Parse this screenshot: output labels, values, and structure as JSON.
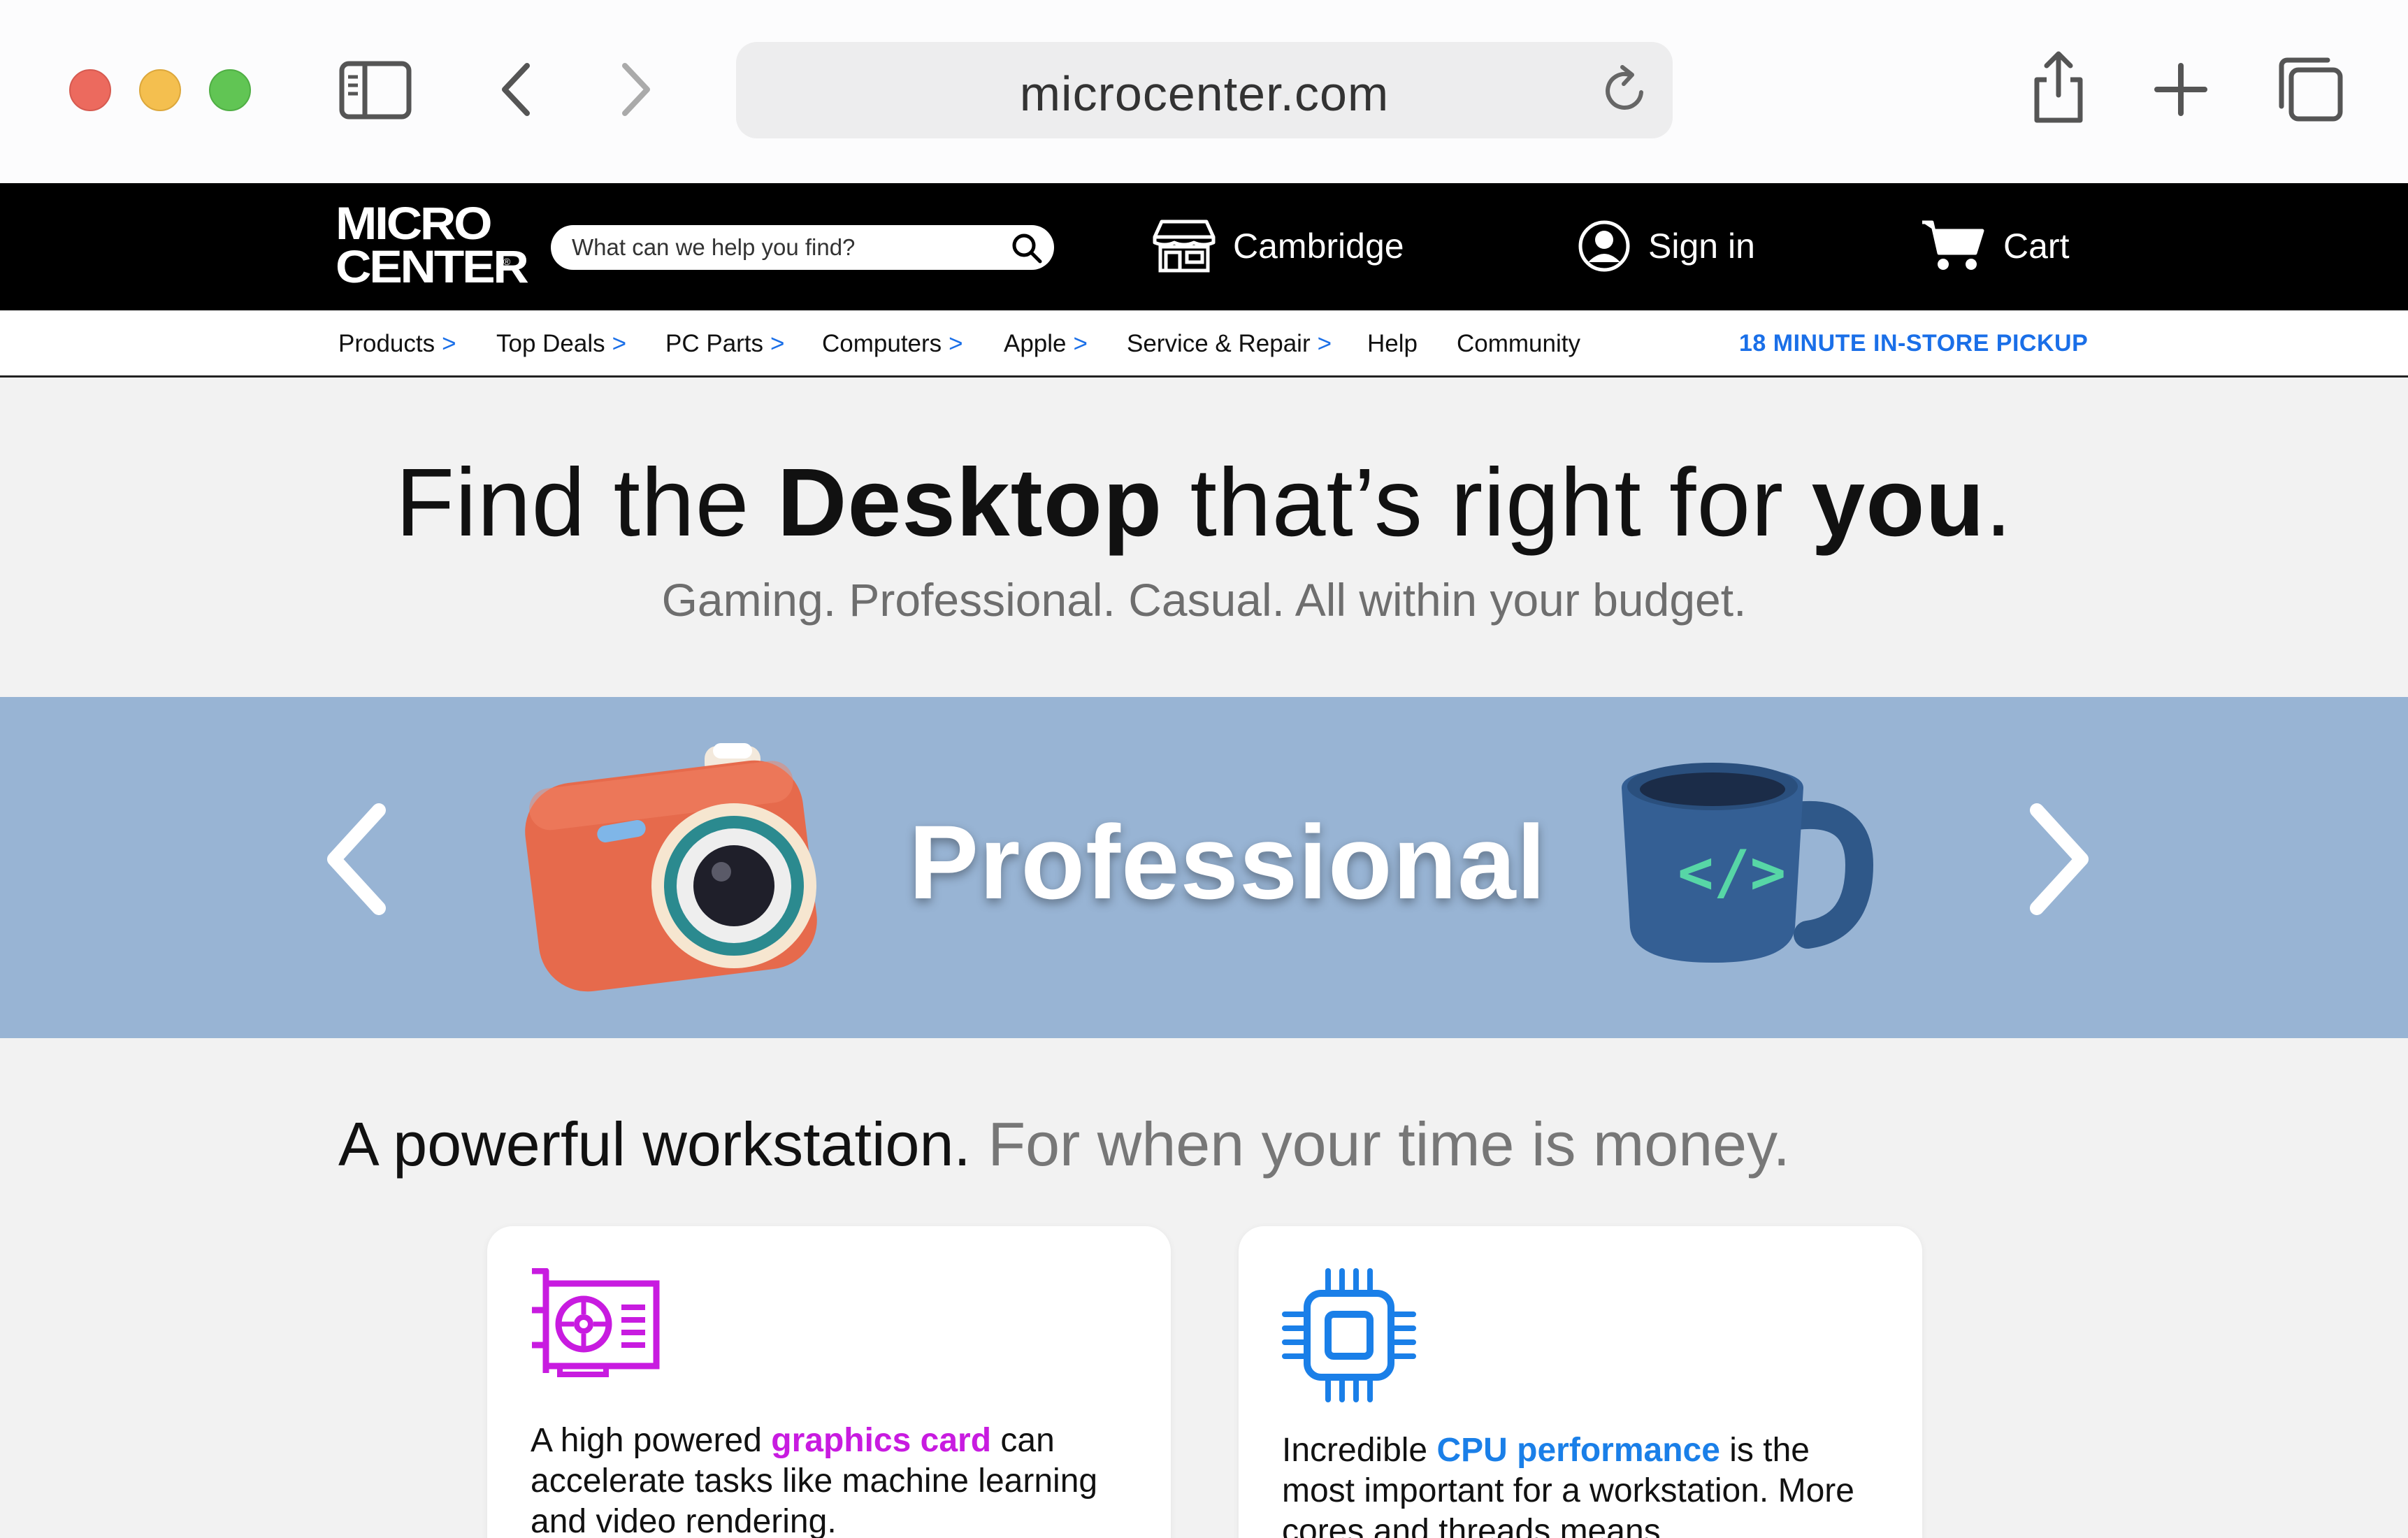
{
  "browser": {
    "url": "microcenter.com",
    "icons": [
      "sidebar-icon",
      "back-icon",
      "forward-icon",
      "reload-icon",
      "share-icon",
      "new-tab-icon",
      "tabs-overview-icon"
    ]
  },
  "header": {
    "logo_line1": "MICRO",
    "logo_line2": "CENTER",
    "logo_reg": "®",
    "search_placeholder": "What can we help you find?",
    "store_label": "Cambridge",
    "signin_label": "Sign in",
    "cart_label": "Cart"
  },
  "nav": {
    "items": [
      {
        "label": "Products",
        "arrow": ">"
      },
      {
        "label": "Top Deals",
        "arrow": ">"
      },
      {
        "label": "PC Parts",
        "arrow": ">"
      },
      {
        "label": "Computers",
        "arrow": ">"
      },
      {
        "label": "Apple",
        "arrow": ">"
      },
      {
        "label": "Service & Repair",
        "arrow": ">"
      },
      {
        "label": "Help",
        "arrow": ""
      },
      {
        "label": "Community",
        "arrow": ""
      }
    ],
    "pickup": "18 MINUTE IN-STORE PICKUP"
  },
  "hero": {
    "title_part1": "Find the ",
    "title_bold1": "Desktop",
    "title_part2": " that’s right for ",
    "title_bold2": "you",
    "title_end": ".",
    "subtitle": "Gaming. Professional. Casual. All within your budget."
  },
  "carousel": {
    "label": "Professional",
    "mug_code": "</>"
  },
  "workstation": {
    "title_strong": "A powerful workstation.",
    "title_muted": " For when your time is money.",
    "cards": [
      {
        "pre": "A high powered ",
        "highlight": "graphics card",
        "post": " can accelerate tasks like machine learning and video rendering."
      },
      {
        "pre": "Incredible ",
        "highlight": "CPU performance",
        "post": " is the most important for a workstation. More cores and threads means"
      }
    ]
  },
  "colors": {
    "accent_blue": "#1a6fe8",
    "carousel_bg": "#98b4d4",
    "highlight_purple": "#c81be0",
    "highlight_blue": "#1a7fe8"
  }
}
